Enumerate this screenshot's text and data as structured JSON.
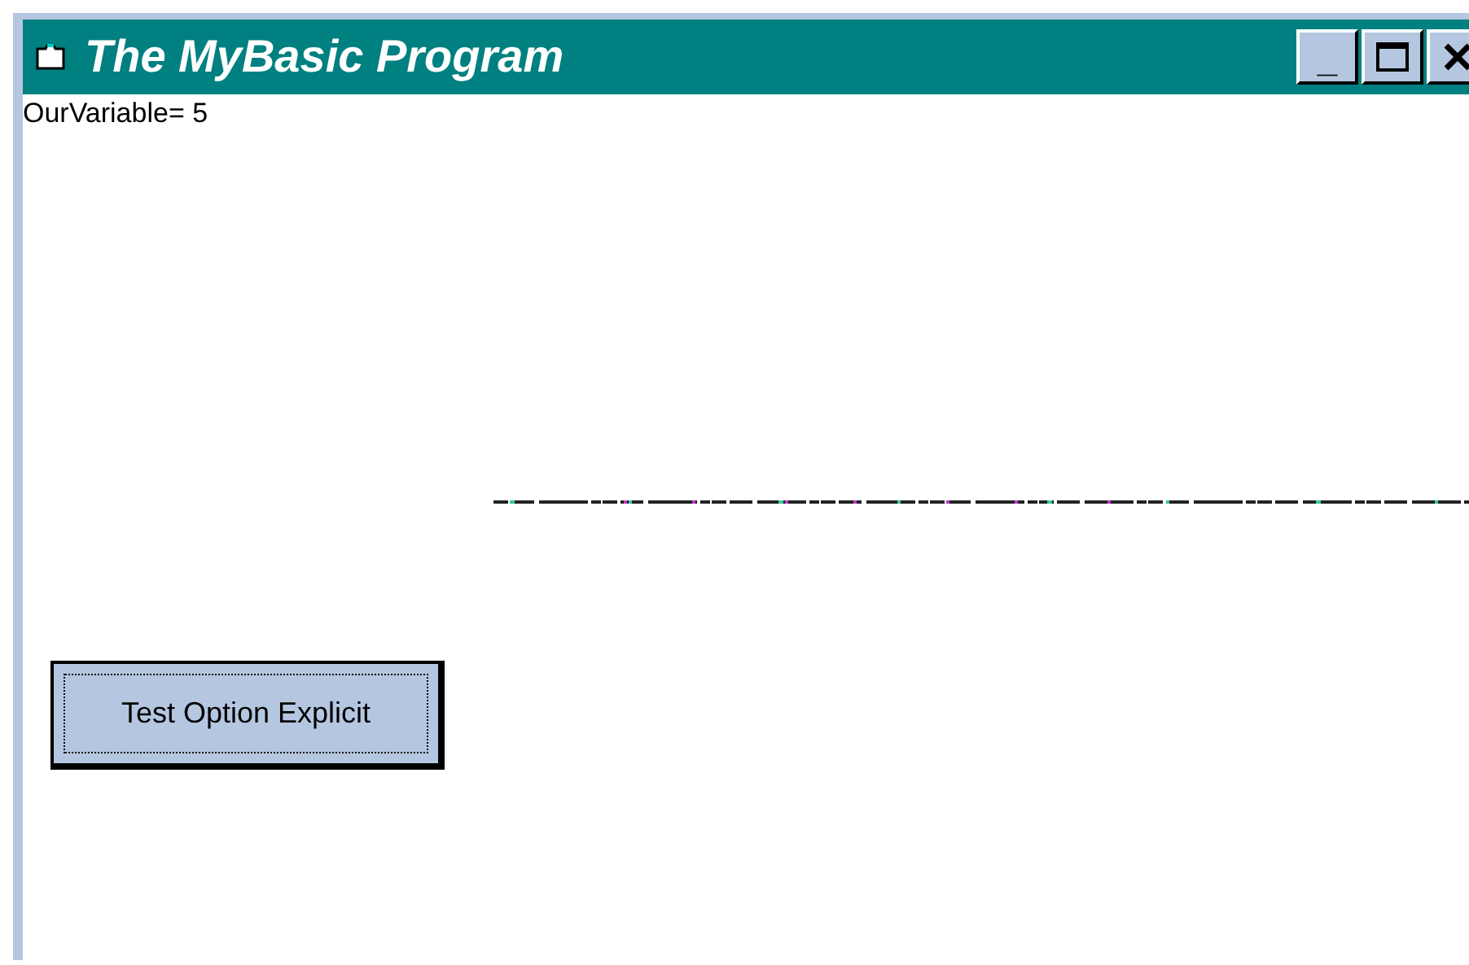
{
  "window": {
    "title": "The MyBasic Program"
  },
  "title_buttons": [
    {
      "kind": "minimize",
      "label": "_"
    },
    {
      "kind": "maximize"
    },
    {
      "kind": "close"
    }
  ],
  "output_text": "OurVariable= 5",
  "button": {
    "label": "Test Option Explicit",
    "focused": true
  }
}
